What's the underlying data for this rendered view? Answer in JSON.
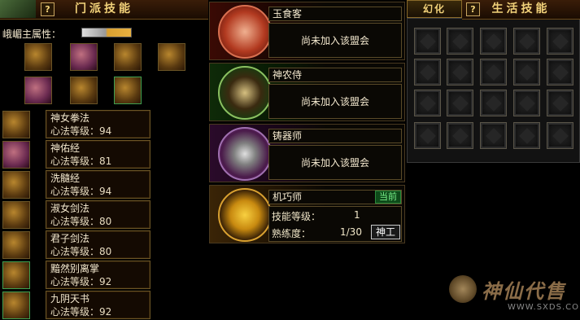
{
  "sect_panel": {
    "help_label": "?",
    "title": "门派技能",
    "main_attr_label": "峨嵋主属性："
  },
  "attr_icons_row1": [
    "scroll-icon",
    "book-red-icon",
    "book-gold-icon",
    "scroll-blue-icon"
  ],
  "attr_icons_row2": [
    "sword-purple-icon",
    "book-brown-icon",
    "book-green-icon"
  ],
  "skills": [
    {
      "name": "神女拳法",
      "level": "心法等级：94"
    },
    {
      "name": "神佑经",
      "level": "心法等级：81"
    },
    {
      "name": "洗髓经",
      "level": "心法等级：94"
    },
    {
      "name": "淑女剑法",
      "level": "心法等级：80"
    },
    {
      "name": "君子剑法",
      "level": "心法等级：80"
    },
    {
      "name": "黯然别离掌",
      "level": "心法等级：92"
    },
    {
      "name": "九阴天书",
      "level": "心法等级：92"
    }
  ],
  "guilds": [
    {
      "name": "玉食客",
      "status": "尚未加入该盟会",
      "color": "#c53a1e"
    },
    {
      "name": "神农侍",
      "status": "尚未加入该盟会",
      "color": "#2f7a2a"
    },
    {
      "name": "铸器师",
      "status": "尚未加入该盟会",
      "color": "#7a3a8a"
    }
  ],
  "mechanic": {
    "name": "机巧师",
    "current_badge": "当前",
    "skill_level_label": "技能等级：",
    "skill_level_value": "1",
    "proficiency_label": "熟练度：",
    "proficiency_value": "1/30",
    "craft_button": "神工"
  },
  "huanhua": {
    "label": "幻化",
    "help_label": "?"
  },
  "life_panel": {
    "help_label": "?",
    "title": "生活技能",
    "slot_count": 20
  },
  "watermark": {
    "brand": "神仙代售",
    "url": "WWW.SXDS.COM"
  }
}
